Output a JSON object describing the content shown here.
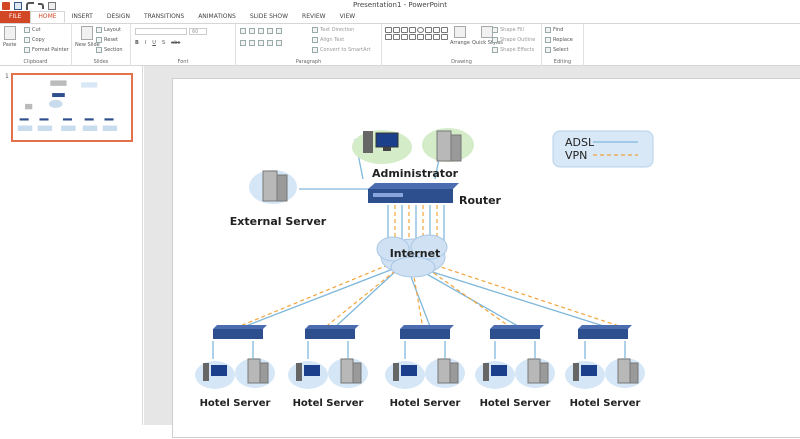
{
  "window": {
    "title": "Presentation1 - PowerPoint"
  },
  "tabs": [
    {
      "label": "FILE"
    },
    {
      "label": "HOME"
    },
    {
      "label": "INSERT"
    },
    {
      "label": "DESIGN"
    },
    {
      "label": "TRANSITIONS"
    },
    {
      "label": "ANIMATIONS"
    },
    {
      "label": "SLIDE SHOW"
    },
    {
      "label": "REVIEW"
    },
    {
      "label": "VIEW"
    }
  ],
  "ribbon": {
    "clipboard": {
      "label": "Clipboard",
      "paste": "Paste",
      "cut": "Cut",
      "copy": "Copy",
      "format_painter": "Format Painter"
    },
    "slides": {
      "label": "Slides",
      "new_slide": "New Slide",
      "layout": "Layout",
      "reset": "Reset",
      "section": "Section"
    },
    "font": {
      "label": "Font",
      "size": "60"
    },
    "paragraph": {
      "label": "Paragraph",
      "text_direction": "Text Direction",
      "align_text": "Align Text",
      "smartart": "Convert to SmartArt"
    },
    "drawing": {
      "label": "Drawing",
      "arrange": "Arrange",
      "quick_styles": "Quick Styles",
      "shape_fill": "Shape Fill",
      "shape_outline": "Shape Outline",
      "shape_effects": "Shape Effects"
    },
    "editing": {
      "label": "Editing",
      "find": "Find",
      "replace": "Replace",
      "select": "Select"
    }
  },
  "thumbnails": [
    {
      "number": "1"
    }
  ],
  "diagram": {
    "administrator": "Administrator",
    "router": "Router",
    "external_server": "External Server",
    "internet": "Internet",
    "legend": {
      "adsl": "ADSL",
      "vpn": "VPN"
    },
    "hotels": [
      "Hotel Server",
      "Hotel Server",
      "Hotel Server",
      "Hotel Server",
      "Hotel Server"
    ],
    "colors": {
      "adsl_line": "#7fb8db",
      "vpn_line": "#f2a43a",
      "router": "#2e4f8e",
      "server_halo": "#d5e6f6",
      "admin_halo": "#d5ecc9",
      "legend_bg": "#d9e8f6"
    }
  }
}
